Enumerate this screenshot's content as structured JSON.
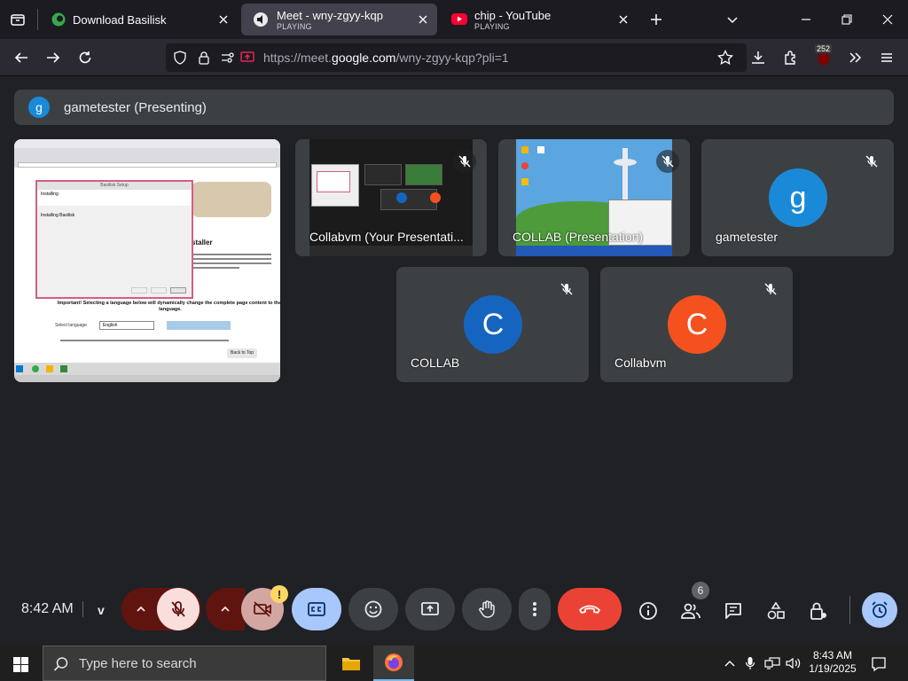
{
  "browser": {
    "tabs": [
      {
        "title": "Download Basilisk",
        "subtitle": ""
      },
      {
        "title": "Meet - wny-zgyy-kqp",
        "subtitle": "PLAYING"
      },
      {
        "title": "chip - YouTube",
        "subtitle": "PLAYING"
      }
    ],
    "url_prefix": "https://meet.",
    "url_domain": "google.com",
    "url_path": "/wny-zgyy-kqp?pli=1",
    "badge_count": "252"
  },
  "meet": {
    "presenting_initial": "g",
    "presenting_label": "gametester (Presenting)",
    "shared_screen": {
      "window_title": "Basilisk Setup",
      "dialog_heading": "Installing",
      "dialog_line": "Installing Basilisk",
      "installer_text": "staller",
      "important_text": "Important! Selecting a language below will dynamically change the complete page content to that language.",
      "language_label": "Select language",
      "language_value": "English",
      "back_to_top": "Back to Top"
    },
    "tiles": [
      {
        "name": "Collabvm (Your Presentati...",
        "kind": "presentation",
        "muted": true
      },
      {
        "name": "COLLAB (Presentation)",
        "kind": "presentation",
        "muted": true
      },
      {
        "name": "gametester",
        "initial": "g",
        "color": "#1a8ad8",
        "muted": true
      },
      {
        "name": "COLLAB",
        "initial": "C",
        "color": "#1565c0",
        "muted": true
      },
      {
        "name": "Collabvm",
        "initial": "C",
        "color": "#f4511e",
        "muted": true
      }
    ],
    "clock": "8:42 AM",
    "clock_sep": "v",
    "people_count": "6",
    "camera_warning": "!"
  },
  "taskbar": {
    "search_placeholder": "Type here to search",
    "time": "8:43 AM",
    "date": "1/19/2025"
  },
  "colors": {
    "meet_bg": "#202124",
    "tile_bg": "#3c4043",
    "end_call": "#ea4335",
    "mic_off_bg": "#f9dedc",
    "captions_bg": "#a8c7fa"
  }
}
